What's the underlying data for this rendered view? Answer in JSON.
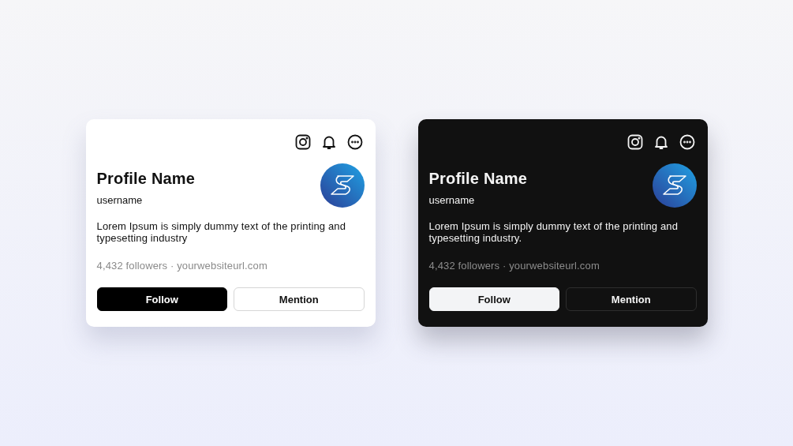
{
  "cards": [
    {
      "kind": "light",
      "name": "Profile Name",
      "username": "username",
      "bio": "Lorem Ipsum is simply dummy text of the printing and typesetting industry",
      "meta": "4,432 followers · yourwebsiteurl.com",
      "buttons": [
        "Follow",
        "Mention"
      ]
    },
    {
      "kind": "dark",
      "name": "Profile Name",
      "username": "username",
      "bio": "Lorem Ipsum is simply dummy text of the printing and typesetting industry.",
      "meta": "4,432 followers · yourwebsiteurl.com",
      "buttons": [
        "Follow",
        "Mention"
      ]
    }
  ]
}
